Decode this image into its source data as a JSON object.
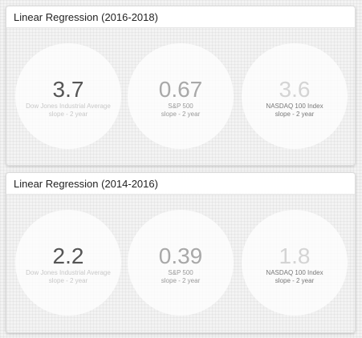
{
  "panels": [
    {
      "title": "Linear Regression (2016-2018)",
      "metrics": [
        {
          "value": "3.7",
          "label": "Dow Jones Industrial Average",
          "sub": "slope - 2 year",
          "value_color": "#555555",
          "label_color": "#c8c8c8"
        },
        {
          "value": "0.67",
          "label": "S&P 500",
          "sub": "slope - 2 year",
          "value_color": "#a8a8a8",
          "label_color": "#999999"
        },
        {
          "value": "3.6",
          "label": "NASDAQ 100 Index",
          "sub": "slope - 2 year",
          "value_color": "#d4d4d4",
          "label_color": "#777777"
        }
      ]
    },
    {
      "title": "Linear Regression (2014-2016)",
      "metrics": [
        {
          "value": "2.2",
          "label": "Dow Jones Industrial Average",
          "sub": "slope - 2 year",
          "value_color": "#555555",
          "label_color": "#c8c8c8"
        },
        {
          "value": "0.39",
          "label": "S&P 500",
          "sub": "slope - 2 year",
          "value_color": "#a8a8a8",
          "label_color": "#999999"
        },
        {
          "value": "1.8",
          "label": "NASDAQ 100 Index",
          "sub": "slope - 2 year",
          "value_color": "#d4d4d4",
          "label_color": "#777777"
        }
      ]
    }
  ]
}
